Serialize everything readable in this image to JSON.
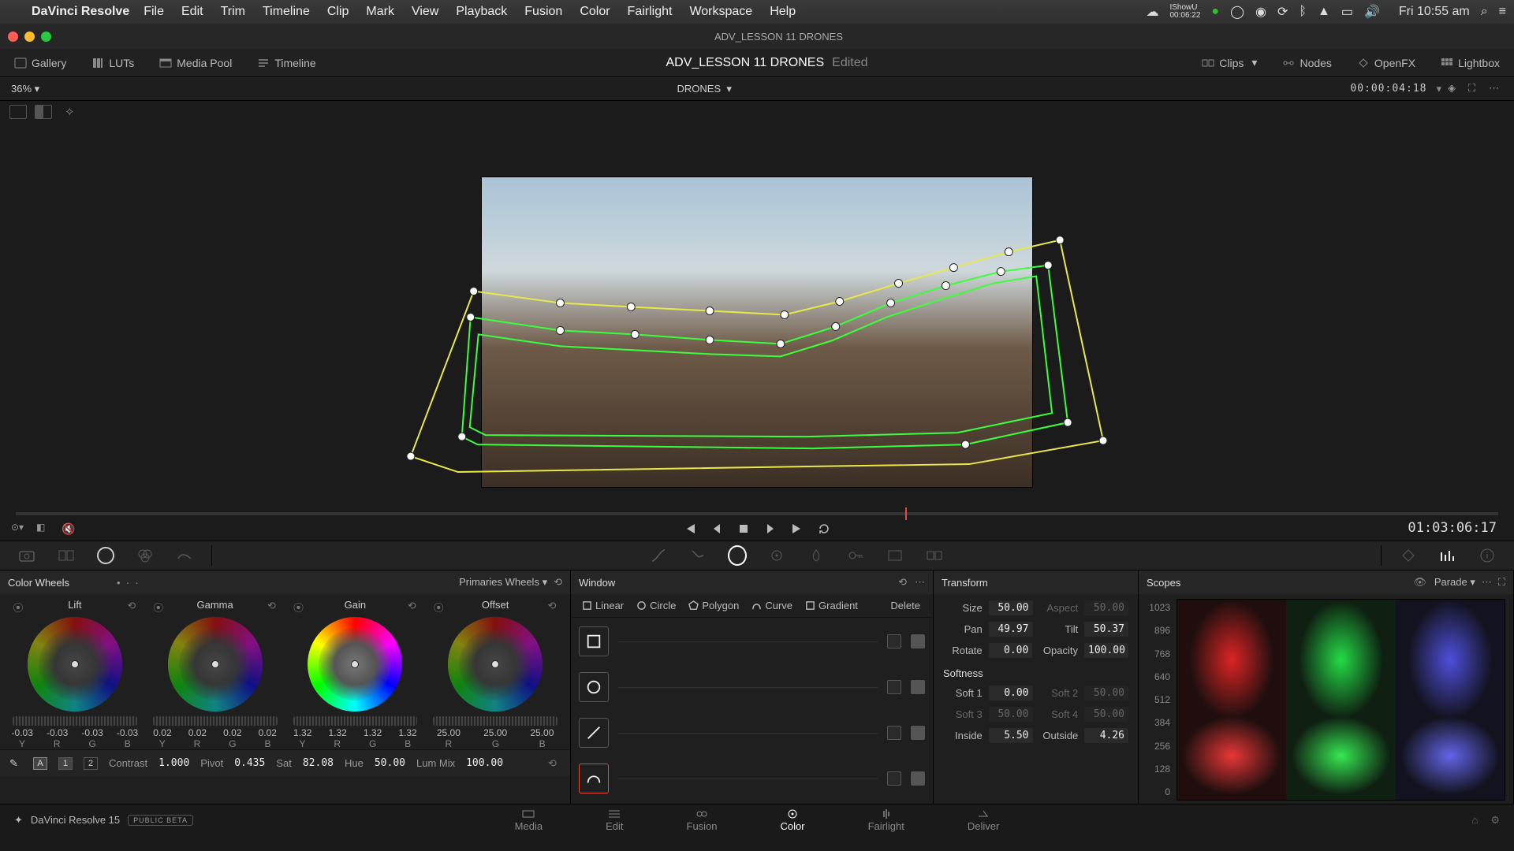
{
  "mac": {
    "app": "DaVinci Resolve",
    "menus": [
      "File",
      "Edit",
      "Trim",
      "Timeline",
      "Clip",
      "Mark",
      "View",
      "Playback",
      "Fusion",
      "Color",
      "Fairlight",
      "Workspace",
      "Help"
    ],
    "clock": "Fri 10:55 am",
    "recorder": "IShowU\n00:06:22"
  },
  "window_title": "ADV_LESSON 11 DRONES",
  "app_toolbar": {
    "left": [
      {
        "id": "gallery",
        "label": "Gallery"
      },
      {
        "id": "luts",
        "label": "LUTs"
      },
      {
        "id": "mediapool",
        "label": "Media Pool"
      },
      {
        "id": "timeline",
        "label": "Timeline"
      }
    ],
    "project": "ADV_LESSON 11 DRONES",
    "edited": "Edited",
    "right": [
      {
        "id": "clips",
        "label": "Clips"
      },
      {
        "id": "nodes",
        "label": "Nodes"
      },
      {
        "id": "openfx",
        "label": "OpenFX"
      },
      {
        "id": "lightbox",
        "label": "Lightbox"
      }
    ]
  },
  "secondary": {
    "zoom": "36%",
    "clip": "DRONES",
    "timecode": "00:00:04:18"
  },
  "viewer": {
    "source_tc": "01:03:06:17"
  },
  "color_wheels": {
    "title": "Color Wheels",
    "mode": "Primaries Wheels",
    "wheels": [
      {
        "name": "Lift",
        "vals": [
          "-0.03",
          "-0.03",
          "-0.03",
          "-0.03"
        ],
        "ch": [
          "Y",
          "R",
          "G",
          "B"
        ]
      },
      {
        "name": "Gamma",
        "vals": [
          "0.02",
          "0.02",
          "0.02",
          "0.02"
        ],
        "ch": [
          "Y",
          "R",
          "G",
          "B"
        ]
      },
      {
        "name": "Gain",
        "vals": [
          "1.32",
          "1.32",
          "1.32",
          "1.32"
        ],
        "ch": [
          "Y",
          "R",
          "G",
          "B"
        ]
      },
      {
        "name": "Offset",
        "vals": [
          "25.00",
          "25.00",
          "25.00"
        ],
        "ch": [
          "R",
          "G",
          "B"
        ]
      }
    ],
    "adjust": {
      "page1": "1",
      "page2": "2",
      "contrast_l": "Contrast",
      "contrast": "1.000",
      "pivot_l": "Pivot",
      "pivot": "0.435",
      "sat_l": "Sat",
      "sat": "82.08",
      "hue_l": "Hue",
      "hue": "50.00",
      "lummix_l": "Lum Mix",
      "lummix": "100.00"
    }
  },
  "window": {
    "title": "Window",
    "tools": [
      "Linear",
      "Circle",
      "Polygon",
      "Curve",
      "Gradient"
    ],
    "delete": "Delete"
  },
  "transform": {
    "title": "Transform",
    "size_l": "Size",
    "size": "50.00",
    "aspect_l": "Aspect",
    "aspect": "50.00",
    "pan_l": "Pan",
    "pan": "49.97",
    "tilt_l": "Tilt",
    "tilt": "50.37",
    "rotate_l": "Rotate",
    "rotate": "0.00",
    "opacity_l": "Opacity",
    "opacity": "100.00",
    "soft_title": "Softness",
    "soft1_l": "Soft 1",
    "soft1": "0.00",
    "soft2_l": "Soft 2",
    "soft2": "50.00",
    "soft3_l": "Soft 3",
    "soft3": "50.00",
    "soft4_l": "Soft 4",
    "soft4": "50.00",
    "inside_l": "Inside",
    "inside": "5.50",
    "outside_l": "Outside",
    "outside": "4.26"
  },
  "scopes": {
    "title": "Scopes",
    "mode": "Parade",
    "ticks": [
      "1023",
      "896",
      "768",
      "640",
      "512",
      "384",
      "256",
      "128",
      "0"
    ]
  },
  "pages": [
    "Media",
    "Edit",
    "Fusion",
    "Color",
    "Fairlight",
    "Deliver"
  ],
  "active_page": "Color",
  "footer": {
    "version": "DaVinci Resolve 15",
    "beta": "PUBLIC BETA"
  }
}
